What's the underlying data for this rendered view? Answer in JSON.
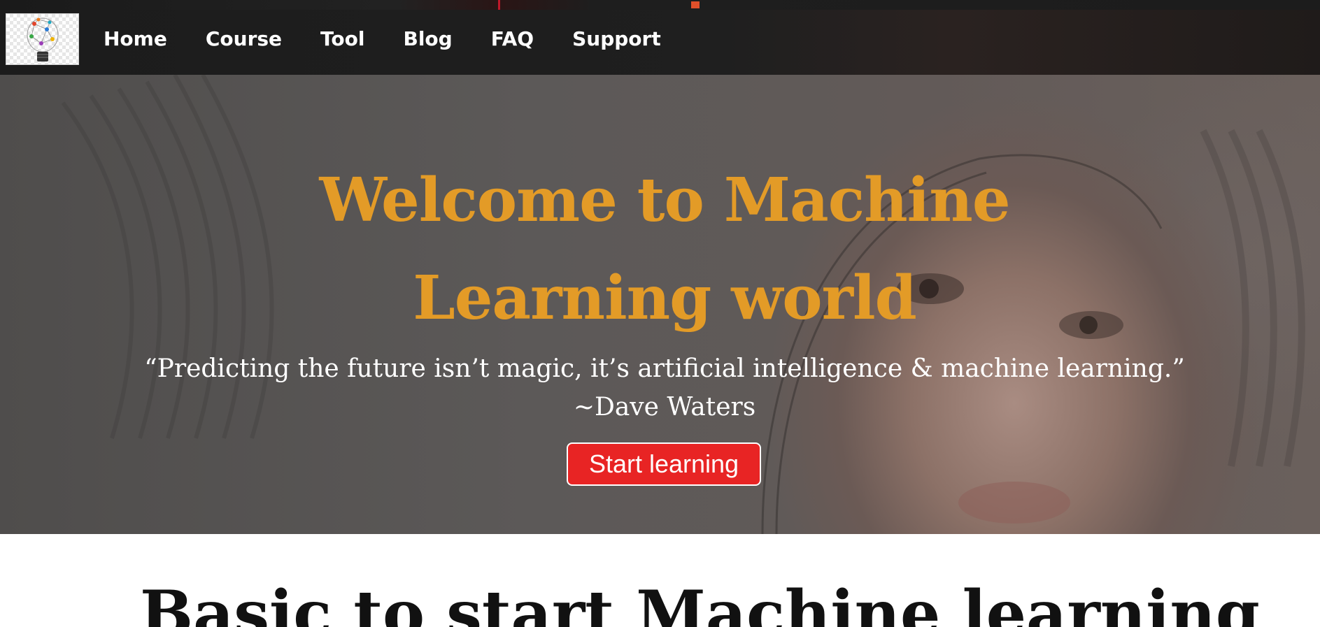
{
  "nav": {
    "logo_alt": "lightbulb-network-logo",
    "links": [
      {
        "label": "Home"
      },
      {
        "label": "Course"
      },
      {
        "label": "Tool"
      },
      {
        "label": "Blog"
      },
      {
        "label": "FAQ"
      },
      {
        "label": "Support"
      }
    ]
  },
  "hero": {
    "title": "Welcome to Machine Learning world",
    "quote": "“Predicting the future isn’t magic, it’s artificial intelligence & machine learning.”",
    "author": "~Dave Waters",
    "button_label": "Start learning"
  },
  "section": {
    "heading": "Basic to start Machine learning"
  },
  "colors": {
    "title_accent": "#e39b27",
    "button_bg": "#e82424",
    "nav_bg": "#1f1f1f"
  }
}
